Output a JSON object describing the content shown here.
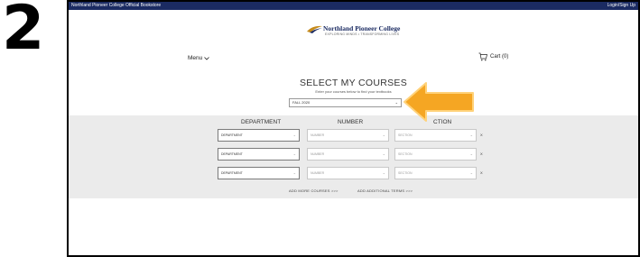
{
  "step_label": "2",
  "topbar": {
    "store_name": "Northland Pioneer College Official Bookstore",
    "login": "Login/Sign Up"
  },
  "logo": {
    "name": "Northland Pioneer College",
    "tagline": "EXPLORING MINDS • TRANSFORMING LIVES"
  },
  "nav": {
    "menu": "Menu",
    "cart": "Cart (0)"
  },
  "course_finder": {
    "title": "SELECT MY COURSES",
    "subtitle": "Enter your courses below to find your textbooks",
    "term_value": "FALL 2020",
    "headers": {
      "department": "DEPARTMENT",
      "number": "NUMBER",
      "section": "CTION"
    },
    "rows": [
      {
        "department": "DEPARTMENT",
        "number": "NUMBER",
        "section": "SECTION",
        "remove": "X"
      },
      {
        "department": "DEPARTMENT",
        "number": "NUMBER",
        "section": "SECTION",
        "remove": "X"
      },
      {
        "department": "DEPARTMENT",
        "number": "NUMBER",
        "section": "SECTION",
        "remove": "X"
      }
    ],
    "add_more_courses": "ADD MORE COURSES >>>",
    "add_terms": "ADD ADDITIONAL TERMS >>>"
  },
  "icons": {
    "menu_caret": "chevron-down-icon",
    "cart": "cart-icon",
    "arrow": "arrow-left-icon",
    "dropdown": "chevron-down-icon"
  },
  "colors": {
    "topbar": "#1b2b62",
    "arrow": "#f5a623",
    "panel": "#ebebeb"
  }
}
